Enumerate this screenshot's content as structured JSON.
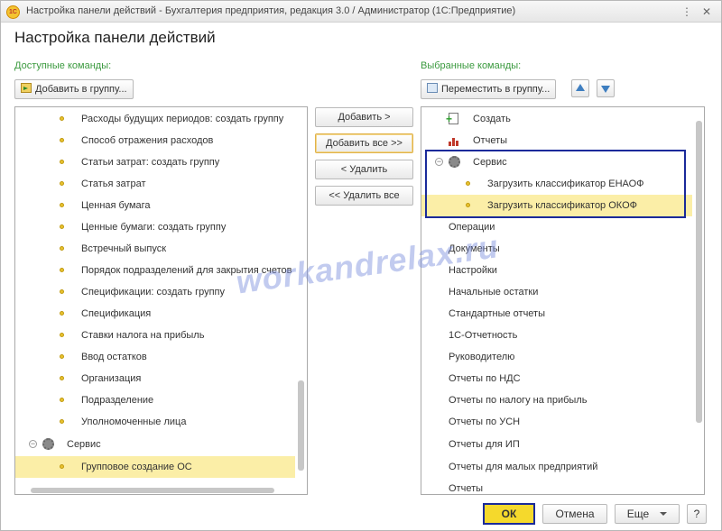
{
  "window": {
    "title": "Настройка панели действий - Бухгалтерия предприятия, редакция 3.0 / Администратор  (1С:Предприятие)",
    "icon_text": "1С"
  },
  "heading": "Настройка панели действий",
  "left": {
    "label": "Доступные команды:",
    "add_to_group_button": "Добавить в группу...",
    "items": [
      "Расходы будущих периодов: создать группу",
      "Способ отражения расходов",
      "Статьи затрат: создать группу",
      "Статья затрат",
      "Ценная бумага",
      "Ценные бумаги: создать группу",
      "Встречный выпуск",
      "Порядок подразделений для закрытия счетов",
      "Спецификации: создать группу",
      "Спецификация",
      "Ставки налога на прибыль",
      "Ввод остатков",
      "Организация",
      "Подразделение",
      "Уполномоченные лица"
    ],
    "group_label": "Сервис",
    "selected_item": "Групповое создание ОС"
  },
  "middle": {
    "add": "Добавить >",
    "add_all": "Добавить все >>",
    "remove": "< Удалить",
    "remove_all": "<< Удалить все"
  },
  "right": {
    "label": "Выбранные команды:",
    "move_to_group_button": "Переместить в группу...",
    "create": "Создать",
    "reports": "Отчеты",
    "service_group": "Сервис",
    "service_items": [
      "Загрузить классификатор ЕНАОФ",
      "Загрузить классификатор ОКОФ"
    ],
    "other_items": [
      "Операции",
      "Документы",
      "Настройки",
      "Начальные остатки",
      "Стандартные отчеты",
      "1С-Отчетность",
      "Руководителю",
      "Отчеты по НДС",
      "Отчеты по налогу на прибыль",
      "Отчеты по УСН",
      "Отчеты для ИП",
      "Отчеты для малых предприятий",
      "Отчеты"
    ]
  },
  "watermark": "workandrelax.ru",
  "footer": {
    "ok": "ОК",
    "cancel": "Отмена",
    "more": "Еще",
    "help": "?"
  },
  "colors": {
    "section_label": "#3b9a3f",
    "selection": "#fbeea7",
    "ok_button": "#f5d92c",
    "highlight_frame": "#1a2a9a",
    "icon_dot": "#e9c22f"
  }
}
